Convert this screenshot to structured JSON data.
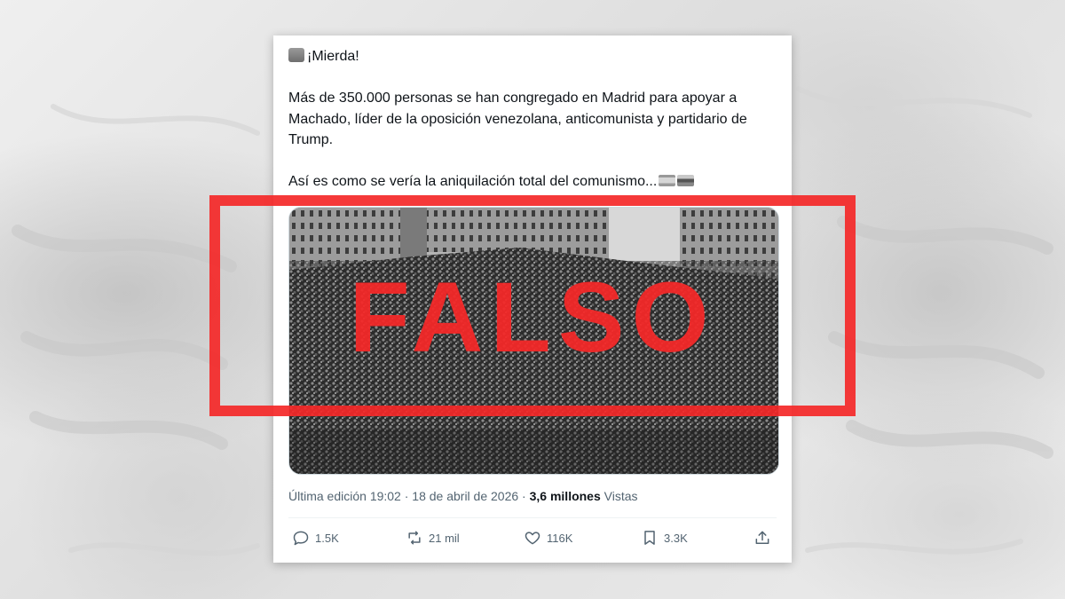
{
  "tweet": {
    "line1": "¡Mierda!",
    "paragraph2": "Más de 350.000 personas se han congregado en Madrid para apoyar a Machado, líder de la oposición venezolana, anticomunista y partidario de Trump.",
    "paragraph3": "Así es como se vería la aniquilación total del comunismo...",
    "emojis": [
      "chair-emoji",
      "spain-flag-emoji",
      "venezuela-flag-emoji"
    ]
  },
  "meta": {
    "edited_prefix": "Última edición 19:02 · 18 de abril de 2026 · ",
    "views_count": "3,6 millones",
    "views_label": " Vistas"
  },
  "actions": {
    "replies": "1.5K",
    "reposts": "21 mil",
    "likes": "116K",
    "bookmarks": "3.3K"
  },
  "icons": [
    "reply-icon",
    "repost-icon",
    "like-icon",
    "bookmark-icon",
    "share-icon"
  ],
  "stamp": {
    "label": "FALSO",
    "color": "#f42828"
  },
  "colors": {
    "text": "#0f1419",
    "muted": "#536471",
    "card": "#ffffff"
  }
}
